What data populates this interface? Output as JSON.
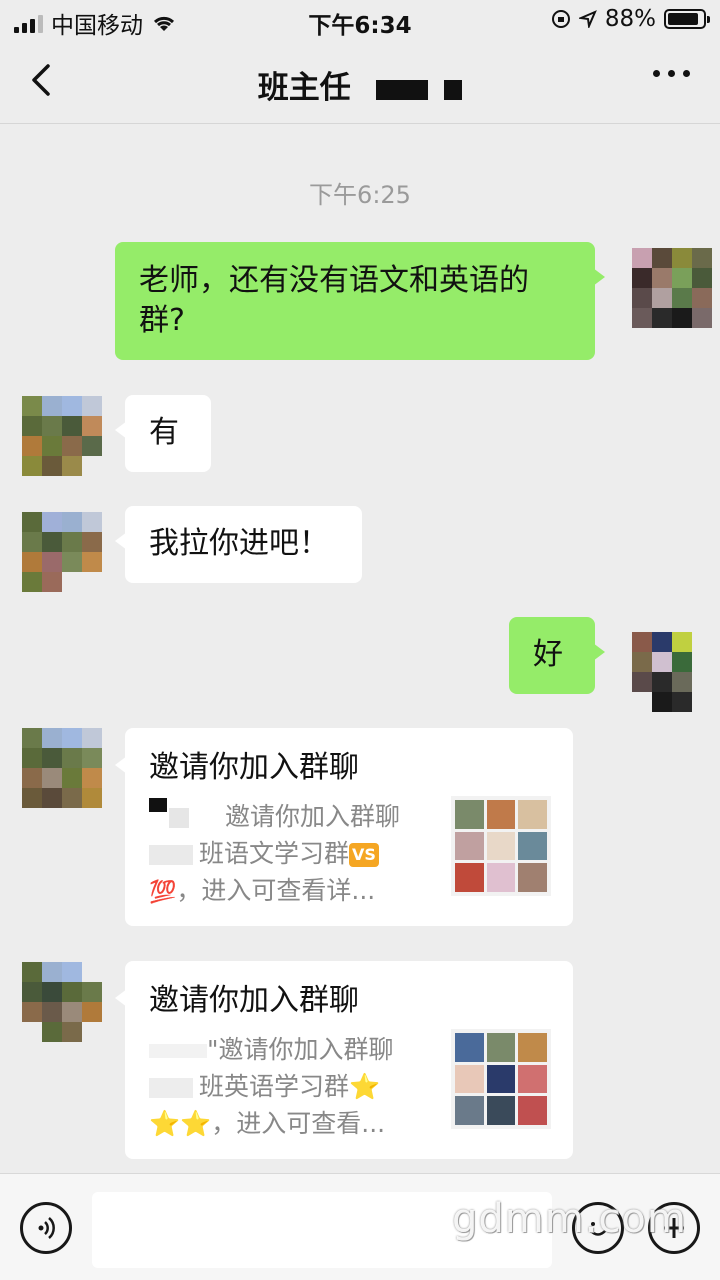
{
  "status_bar": {
    "carrier": "中国移动",
    "time": "下午6:34",
    "battery": "88%",
    "battery_level": 0.88
  },
  "nav": {
    "title": "班主任"
  },
  "chat": {
    "timestamp": "下午6:25",
    "messages": [
      {
        "from": "me",
        "text": "老师，还有没有语文和英语的群?"
      },
      {
        "from": "them",
        "text": "有"
      },
      {
        "from": "them",
        "text": "我拉你进吧！"
      },
      {
        "from": "me",
        "text": "好"
      }
    ],
    "invites": [
      {
        "title": "邀请你加入群聊",
        "line1": "邀请你加入群聊",
        "line2": "班语文学习群",
        "line3": "，进入可查看详..."
      },
      {
        "title": "邀请你加入群聊",
        "line1": "\"邀请你加入群聊",
        "line2": "班英语学习群⭐",
        "line3": "⭐⭐，进入可查看..."
      }
    ]
  },
  "input": {
    "placeholder": ""
  },
  "watermark": "gdmm.com",
  "icons": [
    "back-arrow-icon",
    "more-dots-icon",
    "voice-icon",
    "emoji-icon",
    "plus-icon"
  ]
}
